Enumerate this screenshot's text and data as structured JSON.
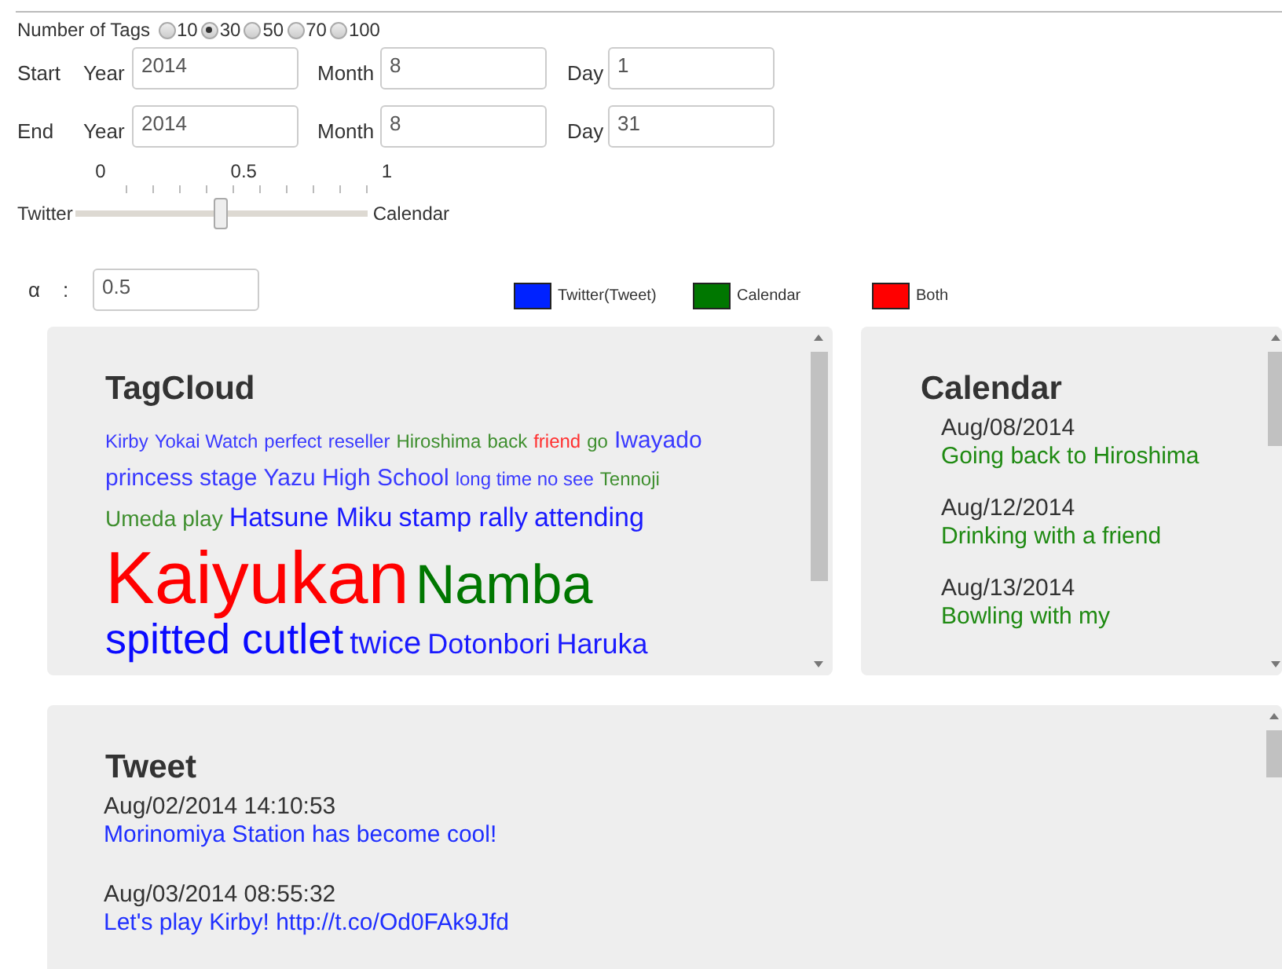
{
  "tag_count": {
    "label": "Number of Tags",
    "options": [
      {
        "label": "10",
        "selected": false
      },
      {
        "label": "30",
        "selected": true
      },
      {
        "label": "50",
        "selected": false
      },
      {
        "label": "70",
        "selected": false
      },
      {
        "label": "100",
        "selected": false
      }
    ]
  },
  "date_rows": [
    {
      "label": "Start",
      "fields": [
        {
          "label": "Year",
          "value": "2014"
        },
        {
          "label": "Month",
          "value": "8"
        },
        {
          "label": "Day",
          "value": "1"
        }
      ]
    },
    {
      "label": "End",
      "fields": [
        {
          "label": "Year",
          "value": "2014"
        },
        {
          "label": "Month",
          "value": "8"
        },
        {
          "label": "Day",
          "value": "31"
        }
      ]
    }
  ],
  "weight_slider": {
    "left_label": "Twitter",
    "right_label": "Calendar",
    "ticks": [
      "0",
      "0.5",
      "1"
    ],
    "level": 0.5
  },
  "alpha": {
    "label": "α",
    "separator": ":",
    "value": "0.5"
  },
  "legend": [
    {
      "label": "Twitter(Tweet)",
      "color": "#0022ff"
    },
    {
      "label": "Calendar",
      "color": "#007700"
    },
    {
      "label": "Both",
      "color": "#ff0000"
    }
  ],
  "tag_cloud": {
    "title": "TagCloud",
    "tags": [
      {
        "text": "Kirby",
        "kind": "tiny",
        "color": "#3a3aff"
      },
      {
        "text": "Yokai Watch",
        "kind": "tiny",
        "color": "#3a3aff"
      },
      {
        "text": "perfect",
        "kind": "tiny",
        "color": "#3a3aff"
      },
      {
        "text": "reseller",
        "kind": "tiny",
        "color": "#3a3aff"
      },
      {
        "text": "Hiroshima",
        "kind": "tiny",
        "color": "#3f8f2f"
      },
      {
        "text": "back",
        "kind": "tiny",
        "color": "#3f8f2f"
      },
      {
        "text": "friend",
        "kind": "tiny",
        "color": "#ff3030"
      },
      {
        "text": "go",
        "kind": "tiny",
        "color": "#3f8f2f"
      },
      {
        "text": "Iwayado",
        "kind": "medium",
        "color": "#3a3aff"
      },
      {
        "text": "princess stage",
        "kind": "medium",
        "color": "#3a3aff"
      },
      {
        "text": "Yazu High School",
        "kind": "medium",
        "color": "#3a3aff"
      },
      {
        "text": "long time no see",
        "kind": "tiny",
        "color": "#3a3aff"
      },
      {
        "text": "Tennoji",
        "kind": "tiny",
        "color": "#3f8f2f"
      },
      {
        "text": "Umeda",
        "kind": "small",
        "color": "#3f8f2f"
      },
      {
        "text": "play",
        "kind": "small",
        "color": "#3f8f2f"
      },
      {
        "text": "Hatsune Miku",
        "kind": "large",
        "color": "#1a1aff"
      },
      {
        "text": "stamp rally",
        "kind": "large",
        "color": "#1a1aff"
      },
      {
        "text": "attending",
        "kind": "large",
        "color": "#1a1aff"
      },
      {
        "text": "Kaiyukan",
        "kind": "max",
        "color": "#ff0000"
      },
      {
        "text": "Namba",
        "kind": "huge",
        "color": "#007700"
      },
      {
        "text": "spitted cutlet",
        "kind": "big",
        "color": "#0a0aff"
      },
      {
        "text": "twice",
        "kind": "xl",
        "color": "#1a1aff"
      },
      {
        "text": "Dotonbori",
        "kind": "larger",
        "color": "#1a1aff"
      },
      {
        "text": "Haruka",
        "kind": "larger",
        "color": "#1a1aff"
      }
    ]
  },
  "calendar": {
    "title": "Calendar",
    "events": [
      {
        "date": "Aug/08/2014",
        "text": "Going back to Hiroshima"
      },
      {
        "date": "Aug/12/2014",
        "text": "Drinking with a friend"
      },
      {
        "date": "Aug/13/2014",
        "text": "Bowling with my"
      }
    ]
  },
  "tweets": {
    "title": "Tweet",
    "items": [
      {
        "date": "Aug/02/2014 14:10:53",
        "text": "Morinomiya Station has become cool!"
      },
      {
        "date": "Aug/03/2014 08:55:32",
        "text": "Let's play Kirby! http://t.co/Od0FAk9Jfd"
      }
    ]
  }
}
